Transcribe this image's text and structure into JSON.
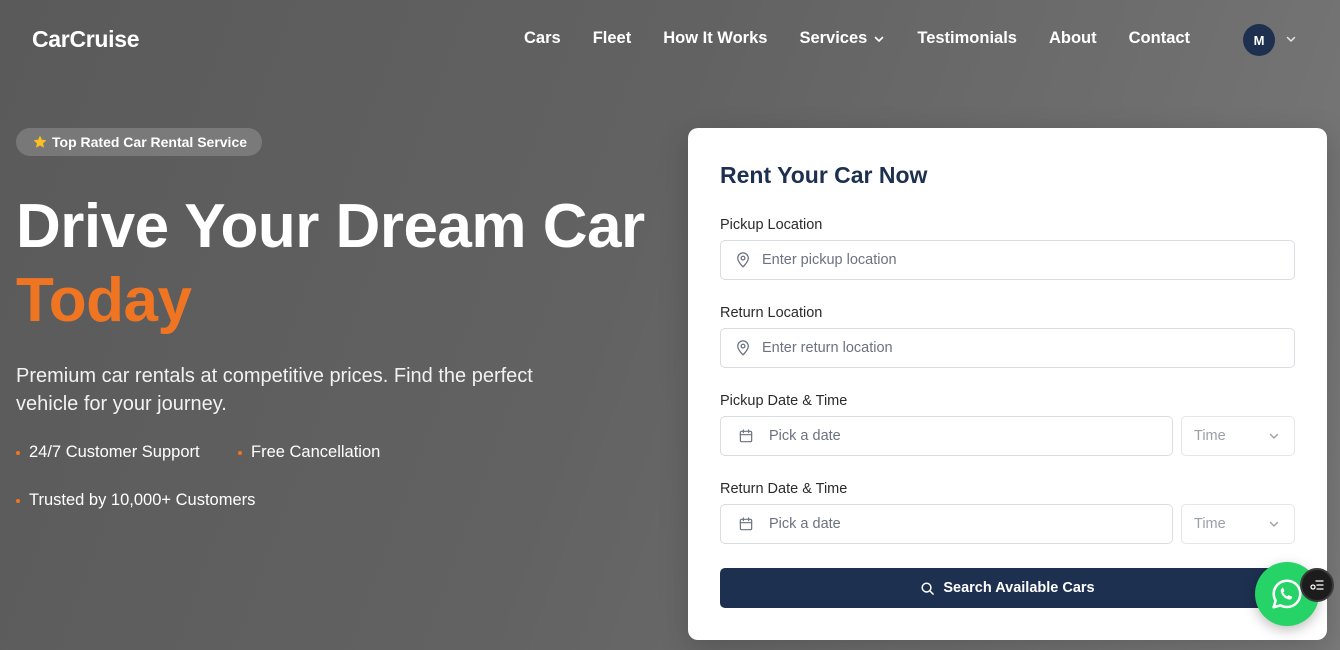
{
  "brand": "CarCruise",
  "nav": {
    "links": [
      "Cars",
      "Fleet",
      "How It Works",
      "Services",
      "Testimonials",
      "About",
      "Contact"
    ],
    "avatar_initial": "M"
  },
  "hero": {
    "badge": "Top Rated Car Rental Service",
    "title_line1": "Drive Your Dream Car",
    "title_line2": "Today",
    "subtitle": "Premium car rentals at competitive prices. Find the perfect vehicle for your journey.",
    "features": [
      "24/7 Customer Support",
      "Free Cancellation",
      "Trusted by 10,000+ Customers"
    ]
  },
  "form": {
    "title": "Rent Your Car Now",
    "pickup_location_label": "Pickup Location",
    "pickup_location_placeholder": "Enter pickup location",
    "return_location_label": "Return Location",
    "return_location_placeholder": "Enter return location",
    "pickup_datetime_label": "Pickup Date & Time",
    "return_datetime_label": "Return Date & Time",
    "date_placeholder": "Pick a date",
    "time_placeholder": "Time",
    "search_button": "Search Available Cars"
  },
  "colors": {
    "accent": "#f07522",
    "primary": "#1e3050",
    "whatsapp": "#25d366"
  },
  "icons": [
    "star-icon",
    "chevron-down-icon",
    "map-pin-icon",
    "calendar-icon",
    "search-icon",
    "whatsapp-icon",
    "menu-widget-icon"
  ]
}
